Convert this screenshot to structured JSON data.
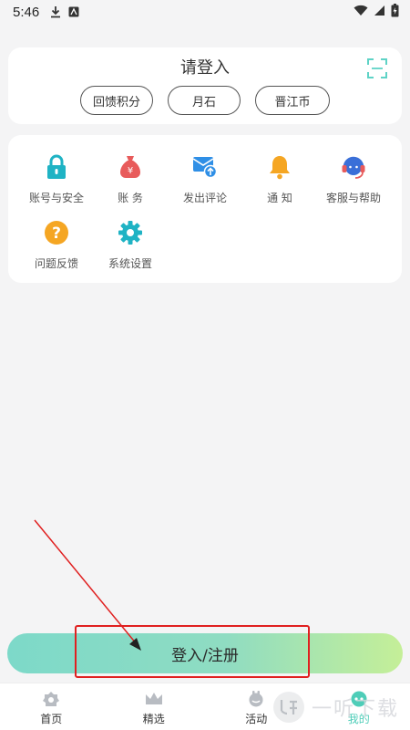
{
  "status_bar": {
    "time": "5:46",
    "icons": [
      "download-icon",
      "app-notification-icon",
      "wifi-icon",
      "signal-icon",
      "battery-charging-icon"
    ]
  },
  "login_card": {
    "title": "请登入",
    "scan_icon": "scan-icon",
    "pills": [
      "回馈积分",
      "月石",
      "晋江币"
    ]
  },
  "menu": {
    "items": [
      {
        "label": "账号与安全",
        "icon": "lock-icon",
        "color": "#1fb3c4"
      },
      {
        "label": "账  务",
        "icon": "money-bag-icon",
        "color": "#e85b5b"
      },
      {
        "label": "发出评论",
        "icon": "mail-upload-icon",
        "color": "#2f8fe6"
      },
      {
        "label": "通  知",
        "icon": "bell-icon",
        "color": "#f5a623"
      },
      {
        "label": "客服与帮助",
        "icon": "headset-icon",
        "color": "#3a6fd8"
      },
      {
        "label": "问题反馈",
        "icon": "question-icon",
        "color": "#f5a623"
      },
      {
        "label": "系统设置",
        "icon": "gear-icon",
        "color": "#1fb3c4"
      }
    ]
  },
  "login_button": {
    "label": "登入/注册"
  },
  "tab_bar": {
    "tabs": [
      {
        "label": "首页",
        "icon": "home-icon"
      },
      {
        "label": "精选",
        "icon": "crown-icon"
      },
      {
        "label": "活动",
        "icon": "activity-icon"
      },
      {
        "label": "我的",
        "icon": "profile-icon",
        "active": true
      }
    ]
  },
  "watermark": {
    "text": "一听下载"
  },
  "colors": {
    "accent": "#4ecdb8",
    "highlight": "#e02020"
  }
}
